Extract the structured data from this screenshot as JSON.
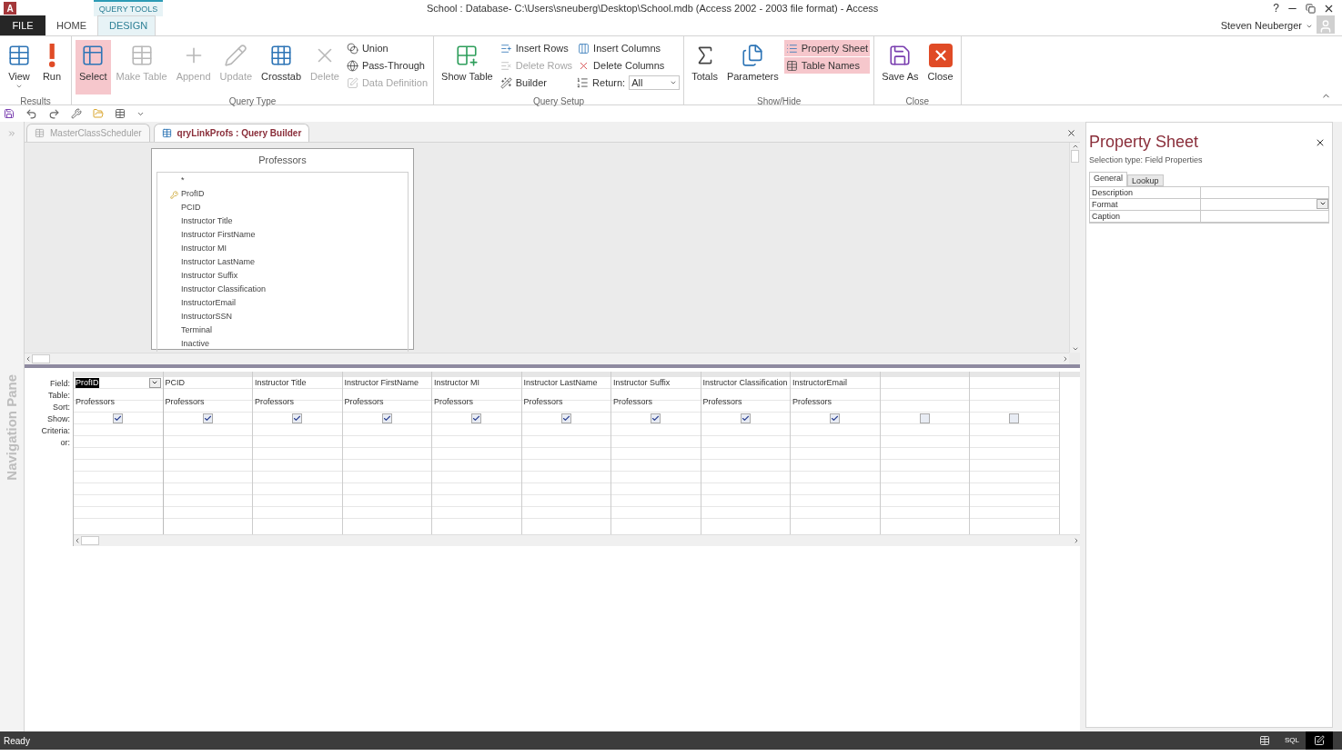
{
  "window": {
    "logo": "A",
    "title": "School : Database- C:\\Users\\sneuberg\\Desktop\\School.mdb (Access 2002 - 2003 file format) - Access",
    "help": "?",
    "user": "Steven Neuberger"
  },
  "context_label": "QUERY TOOLS",
  "ribbon_tabs": [
    {
      "label": "FILE",
      "kind": "file",
      "selected": false
    },
    {
      "label": "HOME",
      "kind": "tab",
      "selected": false
    },
    {
      "label": "DESIGN",
      "kind": "tab",
      "selected": true
    }
  ],
  "ribbon_groups": [
    {
      "name": "Results",
      "buttons": [
        {
          "label": "View",
          "kind": "large",
          "selected": false,
          "disabled": false,
          "has_menu": true
        },
        {
          "label": "Run",
          "kind": "large",
          "selected": false,
          "disabled": false,
          "has_menu": false
        }
      ]
    },
    {
      "name": "Query Type",
      "buttons": [
        {
          "label": "Select",
          "kind": "large",
          "selected": true,
          "disabled": false
        },
        {
          "label": "Make Table",
          "kind": "large",
          "selected": false,
          "disabled": true
        },
        {
          "label": "Append",
          "kind": "large",
          "selected": false,
          "disabled": true
        },
        {
          "label": "Update",
          "kind": "large",
          "selected": false,
          "disabled": true
        },
        {
          "label": "Crosstab",
          "kind": "large",
          "selected": false,
          "disabled": false
        },
        {
          "label": "Delete",
          "kind": "large",
          "selected": false,
          "disabled": true
        },
        {
          "label": "Union",
          "kind": "small",
          "selected": false,
          "disabled": false
        },
        {
          "label": "Pass-Through",
          "kind": "small",
          "selected": false,
          "disabled": false
        },
        {
          "label": "Data Definition",
          "kind": "small",
          "selected": false,
          "disabled": true
        }
      ]
    },
    {
      "name": "Query Setup",
      "buttons": [
        {
          "label": "Show Table",
          "kind": "large",
          "selected": false,
          "disabled": false
        },
        {
          "label": "Insert Rows",
          "kind": "small",
          "selected": false,
          "disabled": false
        },
        {
          "label": "Delete Rows",
          "kind": "small",
          "selected": false,
          "disabled": true
        },
        {
          "label": "Builder",
          "kind": "small",
          "selected": false,
          "disabled": false
        },
        {
          "label": "Insert Columns",
          "kind": "small",
          "selected": false,
          "disabled": false
        },
        {
          "label": "Delete Columns",
          "kind": "small",
          "selected": false,
          "disabled": false
        },
        {
          "label": "Return:",
          "kind": "dropdown",
          "value": "All",
          "selected": false,
          "disabled": false
        }
      ]
    },
    {
      "name": "Show/Hide",
      "buttons": [
        {
          "label": "Totals",
          "kind": "large",
          "selected": false,
          "disabled": false
        },
        {
          "label": "Parameters",
          "kind": "large",
          "selected": false,
          "disabled": false
        },
        {
          "label": "Property Sheet",
          "kind": "small",
          "selected": true,
          "disabled": false
        },
        {
          "label": "Table Names",
          "kind": "small",
          "selected": true,
          "disabled": false
        }
      ]
    },
    {
      "name": "Close",
      "buttons": [
        {
          "label": "Save As",
          "kind": "large",
          "selected": false,
          "disabled": false
        },
        {
          "label": "Close",
          "kind": "large",
          "selected": false,
          "disabled": false
        }
      ]
    }
  ],
  "document_tabs": [
    {
      "label": "MasterClassScheduler",
      "selected": false
    },
    {
      "label": "qryLinkProfs : Query Builder",
      "selected": true
    }
  ],
  "navigation_pane": {
    "label": "Navigation Pane"
  },
  "table_box": {
    "title": "Professors",
    "fields": [
      {
        "name": "*",
        "key": false
      },
      {
        "name": "ProfID",
        "key": true
      },
      {
        "name": "PCID",
        "key": false
      },
      {
        "name": "Instructor Title",
        "key": false
      },
      {
        "name": "Instructor FirstName",
        "key": false
      },
      {
        "name": "Instructor MI",
        "key": false
      },
      {
        "name": "Instructor LastName",
        "key": false
      },
      {
        "name": "Instructor Suffix",
        "key": false
      },
      {
        "name": "Instructor Classification",
        "key": false
      },
      {
        "name": "InstructorEmail",
        "key": false
      },
      {
        "name": "InstructorSSN",
        "key": false
      },
      {
        "name": "Terminal",
        "key": false
      },
      {
        "name": "Inactive",
        "key": false
      }
    ]
  },
  "grid": {
    "row_labels": [
      "Field:",
      "Table:",
      "Sort:",
      "Show:",
      "Criteria:",
      "or:"
    ],
    "columns": [
      {
        "field": "ProfID",
        "table": "Professors",
        "show": true,
        "selected": true
      },
      {
        "field": "PCID",
        "table": "Professors",
        "show": true,
        "selected": false
      },
      {
        "field": "Instructor Title",
        "table": "Professors",
        "show": true,
        "selected": false
      },
      {
        "field": "Instructor FirstName",
        "table": "Professors",
        "show": true,
        "selected": false
      },
      {
        "field": "Instructor MI",
        "table": "Professors",
        "show": true,
        "selected": false
      },
      {
        "field": "Instructor LastName",
        "table": "Professors",
        "show": true,
        "selected": false
      },
      {
        "field": "Instructor Suffix",
        "table": "Professors",
        "show": true,
        "selected": false
      },
      {
        "field": "Instructor Classification",
        "table": "Professors",
        "show": true,
        "selected": false
      },
      {
        "field": "InstructorEmail",
        "table": "Professors",
        "show": true,
        "selected": false
      },
      {
        "show": false,
        "selected": false
      },
      {
        "show": false,
        "selected": false
      }
    ]
  },
  "property_sheet": {
    "title": "Property Sheet",
    "selection_type": "Selection type: Field Properties",
    "tabs": [
      {
        "label": "General",
        "selected": true
      },
      {
        "label": "Lookup",
        "selected": false
      }
    ],
    "properties": [
      {
        "name": "Description",
        "kind": "text"
      },
      {
        "name": "Format",
        "kind": "dropdown"
      },
      {
        "name": "Caption",
        "kind": "text"
      }
    ]
  },
  "status_bar": {
    "text": "Ready",
    "views": [
      {
        "kind": "datasheet",
        "selected": false
      },
      {
        "kind": "sql",
        "label": "SQL",
        "selected": false
      },
      {
        "kind": "design",
        "selected": true
      }
    ]
  }
}
